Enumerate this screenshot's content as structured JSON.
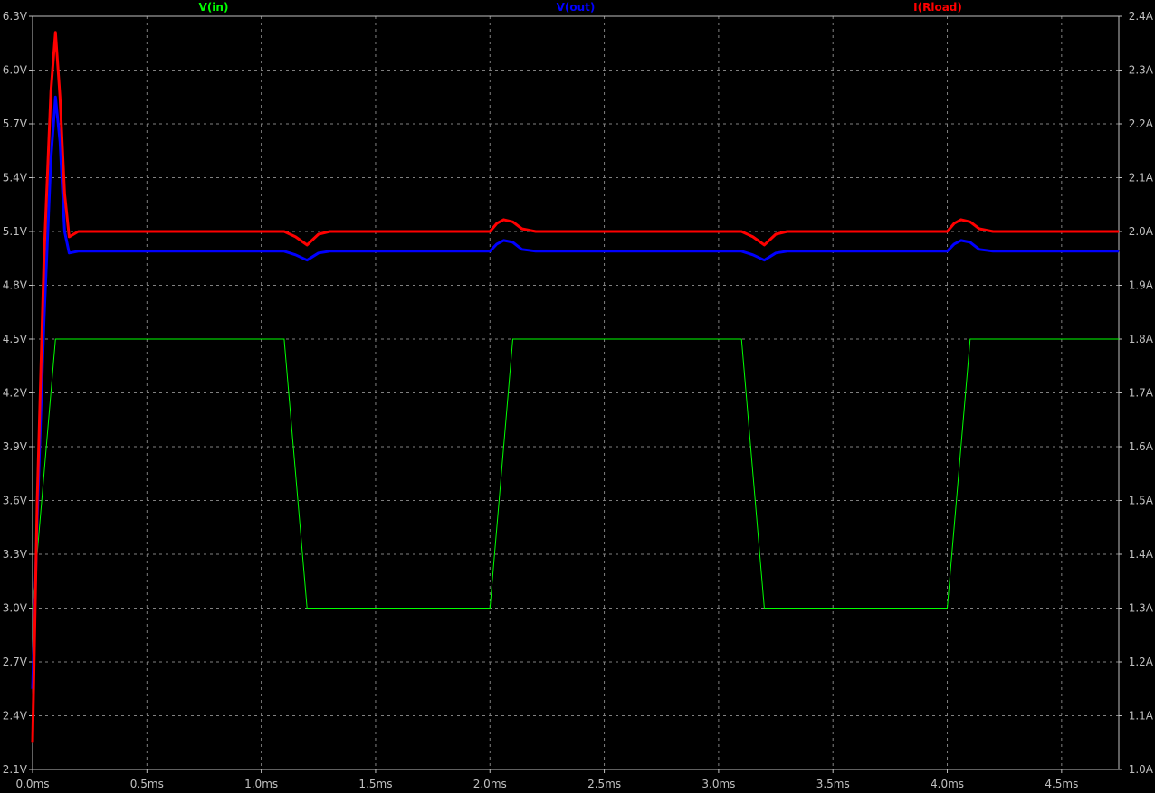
{
  "chart_data": {
    "type": "line",
    "xlim": [
      0,
      4.75
    ],
    "ylim_left": [
      2.1,
      6.3
    ],
    "ylim_right": [
      1.0,
      2.4
    ],
    "grid": true,
    "colors": {
      "background": "#000000",
      "grid": "#808080",
      "axis": "#c0c0c0",
      "tick_label": "#c0c0c0"
    },
    "x_ticks": [
      "0.0ms",
      "0.5ms",
      "1.0ms",
      "1.5ms",
      "2.0ms",
      "2.5ms",
      "3.0ms",
      "3.5ms",
      "4.0ms",
      "4.5ms"
    ],
    "x_tick_values": [
      0,
      0.5,
      1.0,
      1.5,
      2.0,
      2.5,
      3.0,
      3.5,
      4.0,
      4.5
    ],
    "y_left_ticks": [
      "6.3V",
      "6.0V",
      "5.7V",
      "5.4V",
      "5.1V",
      "4.8V",
      "4.5V",
      "4.2V",
      "3.9V",
      "3.6V",
      "3.3V",
      "3.0V",
      "2.7V",
      "2.4V",
      "2.1V"
    ],
    "y_left_tick_values": [
      6.3,
      6.0,
      5.7,
      5.4,
      5.1,
      4.8,
      4.5,
      4.2,
      3.9,
      3.6,
      3.3,
      3.0,
      2.7,
      2.4,
      2.1
    ],
    "y_right_ticks": [
      "2.4A",
      "2.3A",
      "2.2A",
      "2.1A",
      "2.0A",
      "1.9A",
      "1.8A",
      "1.7A",
      "1.6A",
      "1.5A",
      "1.4A",
      "1.3A",
      "1.2A",
      "1.1A",
      "1.0A"
    ],
    "y_right_tick_values": [
      2.4,
      2.3,
      2.2,
      2.1,
      2.0,
      1.9,
      1.8,
      1.7,
      1.6,
      1.5,
      1.4,
      1.3,
      1.2,
      1.1,
      1.0
    ],
    "series": [
      {
        "name": "V(in)",
        "color": "#00ff00",
        "axis": "left",
        "stroke": 1,
        "points": [
          [
            0.0,
            3.0
          ],
          [
            0.1,
            4.5
          ],
          [
            1.1,
            4.5
          ],
          [
            1.2,
            3.0
          ],
          [
            2.0,
            3.0
          ],
          [
            2.1,
            4.5
          ],
          [
            3.1,
            4.5
          ],
          [
            3.2,
            3.0
          ],
          [
            4.0,
            3.0
          ],
          [
            4.1,
            4.5
          ],
          [
            4.75,
            4.5
          ]
        ]
      },
      {
        "name": "V(out)",
        "color": "#0000ff",
        "axis": "left",
        "stroke": 3,
        "points": [
          [
            0.0,
            2.55
          ],
          [
            0.02,
            3.5
          ],
          [
            0.05,
            4.6
          ],
          [
            0.08,
            5.5
          ],
          [
            0.1,
            5.85
          ],
          [
            0.12,
            5.6
          ],
          [
            0.14,
            5.1
          ],
          [
            0.16,
            4.98
          ],
          [
            0.2,
            4.99
          ],
          [
            0.4,
            4.99
          ],
          [
            1.1,
            4.99
          ],
          [
            1.15,
            4.97
          ],
          [
            1.2,
            4.94
          ],
          [
            1.25,
            4.98
          ],
          [
            1.3,
            4.99
          ],
          [
            2.0,
            4.99
          ],
          [
            2.03,
            5.03
          ],
          [
            2.06,
            5.05
          ],
          [
            2.1,
            5.04
          ],
          [
            2.14,
            5.0
          ],
          [
            2.2,
            4.99
          ],
          [
            3.1,
            4.99
          ],
          [
            3.15,
            4.97
          ],
          [
            3.2,
            4.94
          ],
          [
            3.25,
            4.98
          ],
          [
            3.3,
            4.99
          ],
          [
            4.0,
            4.99
          ],
          [
            4.03,
            5.03
          ],
          [
            4.06,
            5.05
          ],
          [
            4.1,
            5.04
          ],
          [
            4.14,
            5.0
          ],
          [
            4.2,
            4.99
          ],
          [
            4.75,
            4.99
          ]
        ]
      },
      {
        "name": "I(Rload)",
        "color": "#ff0000",
        "axis": "right",
        "stroke": 3,
        "points": [
          [
            0.0,
            1.05
          ],
          [
            0.02,
            1.5
          ],
          [
            0.05,
            1.95
          ],
          [
            0.08,
            2.26
          ],
          [
            0.1,
            2.37
          ],
          [
            0.12,
            2.25
          ],
          [
            0.14,
            2.07
          ],
          [
            0.16,
            1.99
          ],
          [
            0.2,
            2.0
          ],
          [
            0.4,
            2.0
          ],
          [
            1.1,
            2.0
          ],
          [
            1.15,
            1.99
          ],
          [
            1.2,
            1.975
          ],
          [
            1.25,
            1.995
          ],
          [
            1.3,
            2.0
          ],
          [
            2.0,
            2.0
          ],
          [
            2.03,
            2.015
          ],
          [
            2.06,
            2.022
          ],
          [
            2.1,
            2.018
          ],
          [
            2.14,
            2.005
          ],
          [
            2.2,
            2.0
          ],
          [
            3.1,
            2.0
          ],
          [
            3.15,
            1.99
          ],
          [
            3.2,
            1.975
          ],
          [
            3.25,
            1.995
          ],
          [
            3.3,
            2.0
          ],
          [
            4.0,
            2.0
          ],
          [
            4.03,
            2.015
          ],
          [
            4.06,
            2.022
          ],
          [
            4.1,
            2.018
          ],
          [
            4.14,
            2.005
          ],
          [
            4.2,
            2.0
          ],
          [
            4.75,
            2.0
          ]
        ]
      }
    ]
  }
}
